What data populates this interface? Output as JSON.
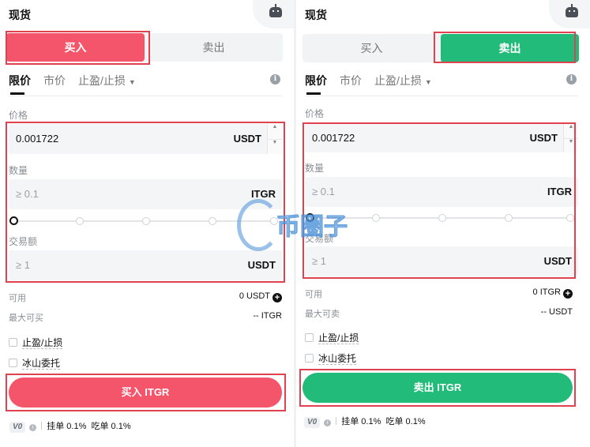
{
  "left": {
    "title": "现货",
    "tabs": {
      "buy": "买入",
      "sell": "卖出"
    },
    "order_types": [
      "限价",
      "市价",
      "止盈/止损"
    ],
    "price": {
      "label": "价格",
      "value": "0.001722",
      "unit": "USDT"
    },
    "amount": {
      "label": "数量",
      "placeholder": "≥ 0.1",
      "unit": "ITGR"
    },
    "total": {
      "label": "交易额",
      "placeholder": "≥ 1",
      "unit": "USDT"
    },
    "available": {
      "label": "可用",
      "value": "0 USDT"
    },
    "max": {
      "label": "最大可买",
      "value": "-- ITGR"
    },
    "options": [
      "止盈/止损",
      "冰山委托"
    ],
    "submit": "买入 ITGR",
    "fees": {
      "level": "V0",
      "maker": "挂单 0.1%",
      "taker": "吃单 0.1%"
    }
  },
  "right": {
    "title": "现货",
    "tabs": {
      "buy": "买入",
      "sell": "卖出"
    },
    "order_types": [
      "限价",
      "市价",
      "止盈/止损"
    ],
    "price": {
      "label": "价格",
      "value": "0.001722",
      "unit": "USDT"
    },
    "amount": {
      "label": "数量",
      "placeholder": "≥ 0.1",
      "unit": "ITGR"
    },
    "total": {
      "label": "交易额",
      "placeholder": "≥ 1",
      "unit": "USDT"
    },
    "available": {
      "label": "可用",
      "value": "0 ITGR"
    },
    "max": {
      "label": "最大可卖",
      "value": "-- USDT"
    },
    "options": [
      "止盈/止损",
      "冰山委托"
    ],
    "submit": "卖出 ITGR",
    "fees": {
      "level": "V0",
      "maker": "挂单 0.1%",
      "taker": "吃单 0.1%"
    }
  },
  "watermark": "币圈子",
  "colors": {
    "buy": "#f4556a",
    "sell": "#22bb7a",
    "highlight": "#e0434f"
  }
}
